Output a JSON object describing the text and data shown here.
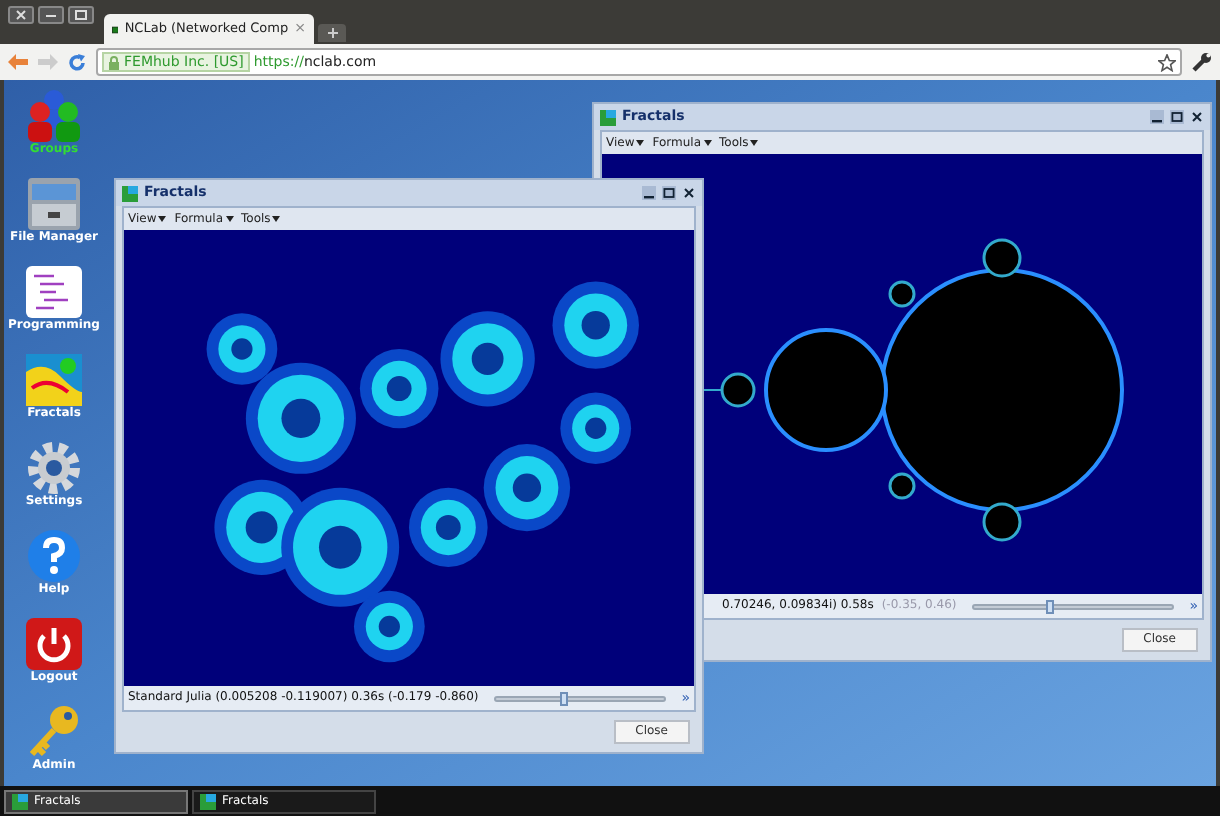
{
  "browser": {
    "tab_title": "NCLab (Networked Comp",
    "tab_close": "×",
    "identity": "FEMhub Inc. [US]",
    "url_scheme": "https://",
    "url_host": "nclab.com"
  },
  "desktop_icons": [
    {
      "label": "Groups",
      "kind": "groups",
      "selected": true
    },
    {
      "label": "File Manager",
      "kind": "files",
      "selected": false
    },
    {
      "label": "Programming",
      "kind": "code",
      "selected": false
    },
    {
      "label": "Fractals",
      "kind": "fractal",
      "selected": false
    },
    {
      "label": "Settings",
      "kind": "gear",
      "selected": false
    },
    {
      "label": "Help",
      "kind": "help",
      "selected": false
    },
    {
      "label": "Logout",
      "kind": "power",
      "selected": false
    },
    {
      "label": "Admin",
      "kind": "key",
      "selected": false
    }
  ],
  "windows": [
    {
      "title": "Fractals",
      "kind": "mandelbrot",
      "menus": [
        "View",
        "Formula",
        "Tools"
      ],
      "status": "0.70246, 0.09834i) 0.58s",
      "status_hint": "(-0.35, 0.46)",
      "slider": {
        "level": 0.38
      },
      "more": "»",
      "close": "Close"
    },
    {
      "title": "Fractals",
      "kind": "julia",
      "menus": [
        "View",
        "Formula",
        "Tools"
      ],
      "status": "Standard Julia  (0.005208 -0.119007) 0.36s  (-0.179 -0.860)",
      "slider": {
        "level": 0.4
      },
      "more": "»",
      "close": "Close"
    }
  ],
  "taskbar": [
    {
      "label": "Fractals",
      "selected": true
    },
    {
      "label": "Fractals",
      "selected": false
    }
  ]
}
